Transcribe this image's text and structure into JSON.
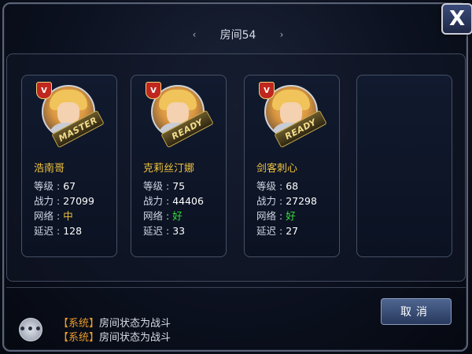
{
  "window": {
    "title": "房间54",
    "close_glyph": "X"
  },
  "players": [
    {
      "name": "浩南哥",
      "status": "MASTER",
      "vip": "V",
      "level_label": "等级",
      "level": "67",
      "power_label": "战力",
      "power": "27099",
      "network_label": "网络",
      "network": "中",
      "latency_label": "延迟",
      "latency": "128"
    },
    {
      "name": "克莉丝汀娜",
      "status": "READY",
      "vip": "V",
      "level_label": "等级",
      "level": "75",
      "power_label": "战力",
      "power": "44406",
      "network_label": "网络",
      "network": "好",
      "latency_label": "延迟",
      "latency": "33"
    },
    {
      "name": "剑客刺心",
      "status": "READY",
      "vip": "V",
      "level_label": "等级",
      "level": "68",
      "power_label": "战力",
      "power": "27298",
      "network_label": "网络",
      "network": "好",
      "latency_label": "延迟",
      "latency": "27"
    }
  ],
  "chat": {
    "messages": [
      {
        "tag": "【系统】",
        "text": "房间状态为战斗"
      },
      {
        "tag": "【系统】",
        "text": "房间状态为战斗"
      }
    ]
  },
  "buttons": {
    "cancel": "取消"
  },
  "colors": {
    "name": "#f0c33d",
    "network_good": "#35e03c",
    "network_mid": "#f0c33d",
    "system_tag": "#e89a2b"
  }
}
